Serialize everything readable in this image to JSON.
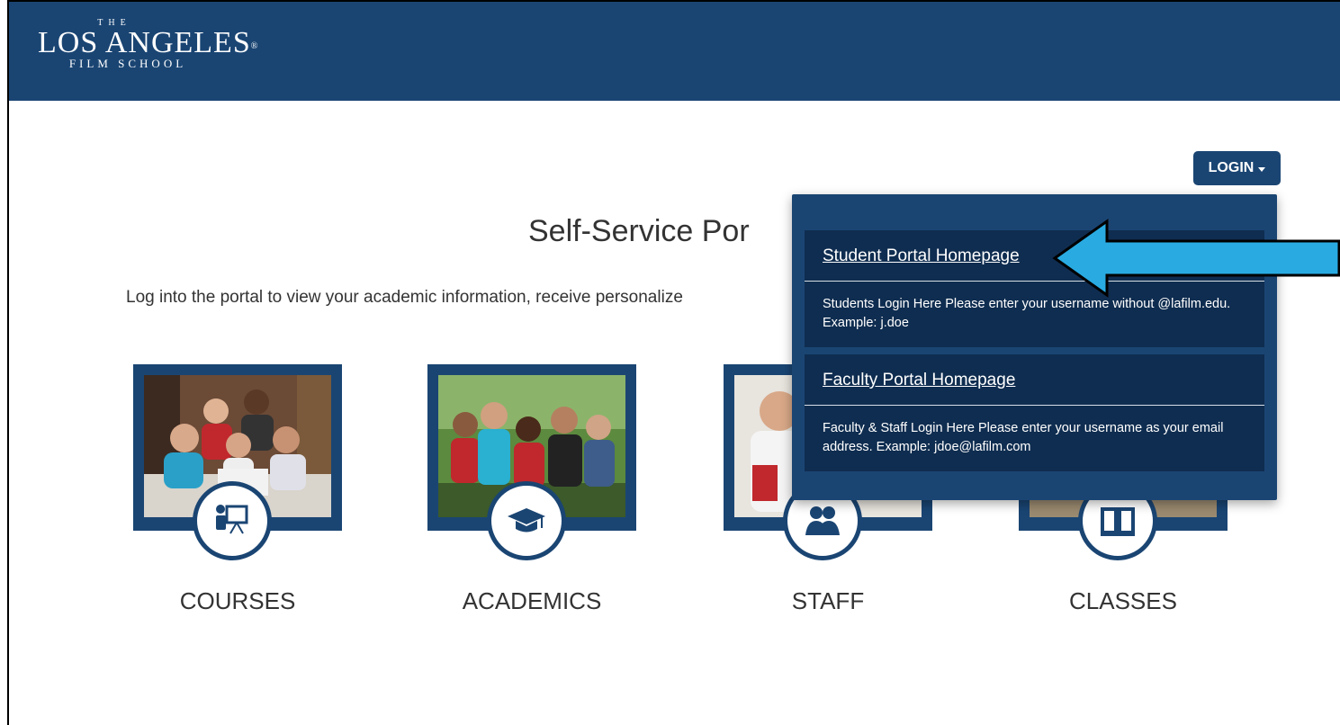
{
  "header": {
    "logo": {
      "the": "THE",
      "main": "LOS ANGELES",
      "registered": "®",
      "sub": "FILM SCHOOL"
    }
  },
  "login": {
    "label": "LOGIN"
  },
  "main": {
    "title": "Self-Service Por",
    "intro": "Log into the portal to view your academic information, receive personalize"
  },
  "cards": [
    {
      "label": "COURSES",
      "icon": "presentation-icon"
    },
    {
      "label": "ACADEMICS",
      "icon": "graduation-cap-icon"
    },
    {
      "label": "STAFF",
      "icon": "users-icon"
    },
    {
      "label": "CLASSES",
      "icon": "book-icon"
    }
  ],
  "dropdown": {
    "items": [
      {
        "title": "Student Portal Homepage",
        "description": "Students Login Here Please enter your username without @lafilm.edu. Example: j.doe"
      },
      {
        "title": "Faculty Portal Homepage",
        "description": "Faculty & Staff Login Here Please enter your username as your email address. Example: jdoe@lafilm.com"
      }
    ]
  },
  "colors": {
    "brand": "#1a4573",
    "dropdown_item": "#0f2d50",
    "arrow": "#29abe2"
  }
}
